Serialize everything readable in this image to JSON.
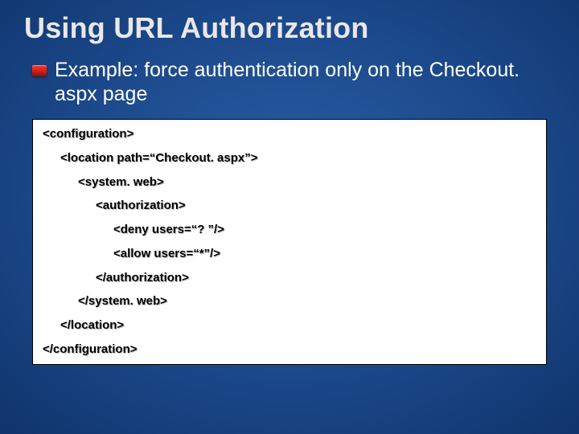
{
  "title": "Using URL Authorization",
  "bullet": "Example: force authentication only on the Checkout. aspx page",
  "code": {
    "l0": "<configuration>",
    "l1": "<location path=“Checkout. aspx”>",
    "l2": "<system. web>",
    "l3": "<authorization>",
    "l4": "<deny users=“? ”/>",
    "l5": "<allow users=“*”/>",
    "l6": "</authorization>",
    "l7": "</system. web>",
    "l8": "</location>",
    "l9": "</configuration>"
  }
}
